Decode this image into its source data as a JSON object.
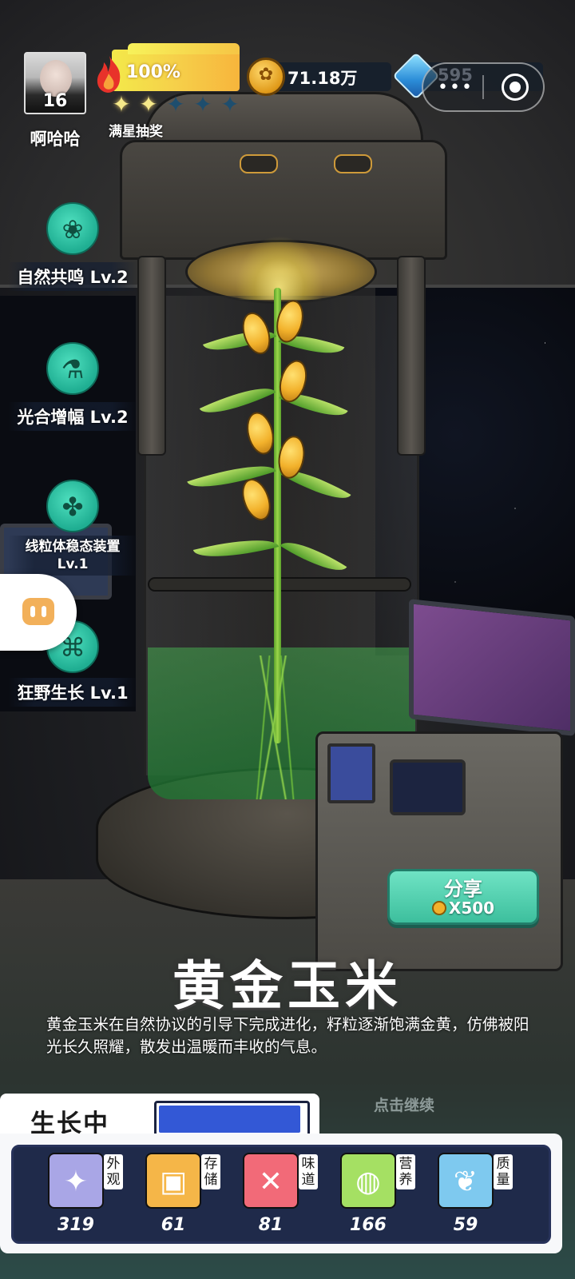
{
  "player": {
    "name": "啊哈哈",
    "level": "16"
  },
  "energy": {
    "percent_label": "100%",
    "lottery_label": "满星抽奖",
    "stars": [
      "on",
      "on",
      "off",
      "off",
      "off"
    ]
  },
  "currency": {
    "coins": "71.18万",
    "gems": "595"
  },
  "skills": [
    {
      "icon": "leaf-face-icon",
      "glyph": "❀",
      "label": "自然共鸣 Lv.2"
    },
    {
      "icon": "flask-icon",
      "glyph": "⚗",
      "label": "光合增幅 Lv.2"
    },
    {
      "icon": "plant-cell-icon",
      "glyph": "✤",
      "label": "线粒体稳态装置 Lv.1"
    },
    {
      "icon": "dna-icon",
      "glyph": "⌘",
      "label": "狂野生长 Lv.1"
    }
  ],
  "share": {
    "label": "分享",
    "cost": "X500"
  },
  "crop": {
    "name": "黄金玉米",
    "description": "黄金玉米在自然协议的引导下完成进化，籽粒逐渐饱满金黄，仿佛被阳光长久照耀，散发出温暖而丰收的气息。"
  },
  "continue_hint": "点击继续",
  "status": {
    "label": "生长中",
    "progress": 0.97
  },
  "attributes": [
    {
      "icon": "sparkle-icon",
      "glyph": "✦",
      "color": "#a9a6e6",
      "tag": "外观",
      "value": "319"
    },
    {
      "icon": "box-icon",
      "glyph": "▣",
      "color": "#f5b648",
      "tag": "存储",
      "value": "61"
    },
    {
      "icon": "fork-spoon-icon",
      "glyph": "✕",
      "color": "#f26a78",
      "tag": "味道",
      "value": "81"
    },
    {
      "icon": "fruit-icon",
      "glyph": "◍",
      "color": "#a5e063",
      "tag": "营养",
      "value": "166"
    },
    {
      "icon": "muscle-icon",
      "glyph": "❦",
      "color": "#7ec9ef",
      "tag": "质量",
      "value": "59"
    }
  ]
}
